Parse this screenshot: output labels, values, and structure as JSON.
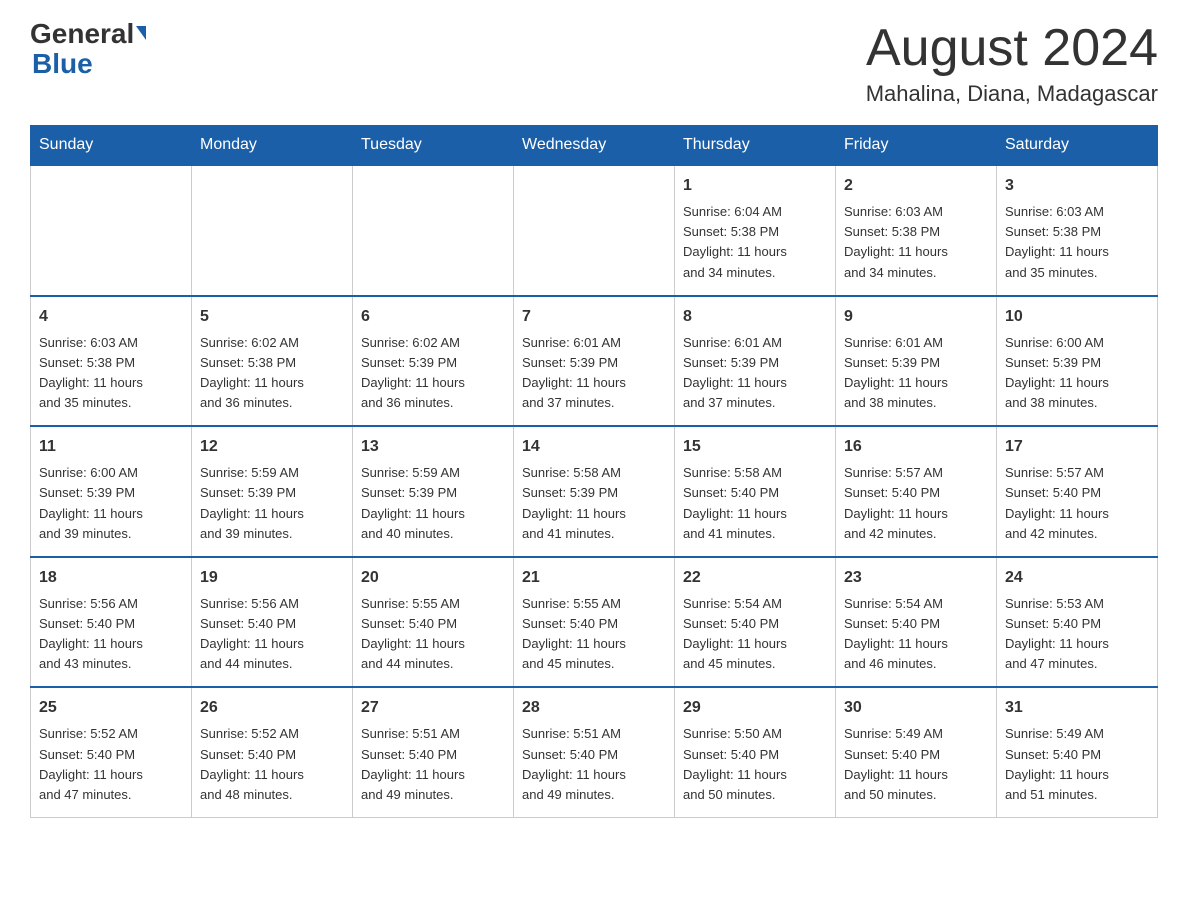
{
  "logo": {
    "general": "General",
    "blue": "Blue"
  },
  "title": "August 2024",
  "subtitle": "Mahalina, Diana, Madagascar",
  "days_of_week": [
    "Sunday",
    "Monday",
    "Tuesday",
    "Wednesday",
    "Thursday",
    "Friday",
    "Saturday"
  ],
  "weeks": [
    [
      {
        "day": "",
        "info": ""
      },
      {
        "day": "",
        "info": ""
      },
      {
        "day": "",
        "info": ""
      },
      {
        "day": "",
        "info": ""
      },
      {
        "day": "1",
        "info": "Sunrise: 6:04 AM\nSunset: 5:38 PM\nDaylight: 11 hours\nand 34 minutes."
      },
      {
        "day": "2",
        "info": "Sunrise: 6:03 AM\nSunset: 5:38 PM\nDaylight: 11 hours\nand 34 minutes."
      },
      {
        "day": "3",
        "info": "Sunrise: 6:03 AM\nSunset: 5:38 PM\nDaylight: 11 hours\nand 35 minutes."
      }
    ],
    [
      {
        "day": "4",
        "info": "Sunrise: 6:03 AM\nSunset: 5:38 PM\nDaylight: 11 hours\nand 35 minutes."
      },
      {
        "day": "5",
        "info": "Sunrise: 6:02 AM\nSunset: 5:38 PM\nDaylight: 11 hours\nand 36 minutes."
      },
      {
        "day": "6",
        "info": "Sunrise: 6:02 AM\nSunset: 5:39 PM\nDaylight: 11 hours\nand 36 minutes."
      },
      {
        "day": "7",
        "info": "Sunrise: 6:01 AM\nSunset: 5:39 PM\nDaylight: 11 hours\nand 37 minutes."
      },
      {
        "day": "8",
        "info": "Sunrise: 6:01 AM\nSunset: 5:39 PM\nDaylight: 11 hours\nand 37 minutes."
      },
      {
        "day": "9",
        "info": "Sunrise: 6:01 AM\nSunset: 5:39 PM\nDaylight: 11 hours\nand 38 minutes."
      },
      {
        "day": "10",
        "info": "Sunrise: 6:00 AM\nSunset: 5:39 PM\nDaylight: 11 hours\nand 38 minutes."
      }
    ],
    [
      {
        "day": "11",
        "info": "Sunrise: 6:00 AM\nSunset: 5:39 PM\nDaylight: 11 hours\nand 39 minutes."
      },
      {
        "day": "12",
        "info": "Sunrise: 5:59 AM\nSunset: 5:39 PM\nDaylight: 11 hours\nand 39 minutes."
      },
      {
        "day": "13",
        "info": "Sunrise: 5:59 AM\nSunset: 5:39 PM\nDaylight: 11 hours\nand 40 minutes."
      },
      {
        "day": "14",
        "info": "Sunrise: 5:58 AM\nSunset: 5:39 PM\nDaylight: 11 hours\nand 41 minutes."
      },
      {
        "day": "15",
        "info": "Sunrise: 5:58 AM\nSunset: 5:40 PM\nDaylight: 11 hours\nand 41 minutes."
      },
      {
        "day": "16",
        "info": "Sunrise: 5:57 AM\nSunset: 5:40 PM\nDaylight: 11 hours\nand 42 minutes."
      },
      {
        "day": "17",
        "info": "Sunrise: 5:57 AM\nSunset: 5:40 PM\nDaylight: 11 hours\nand 42 minutes."
      }
    ],
    [
      {
        "day": "18",
        "info": "Sunrise: 5:56 AM\nSunset: 5:40 PM\nDaylight: 11 hours\nand 43 minutes."
      },
      {
        "day": "19",
        "info": "Sunrise: 5:56 AM\nSunset: 5:40 PM\nDaylight: 11 hours\nand 44 minutes."
      },
      {
        "day": "20",
        "info": "Sunrise: 5:55 AM\nSunset: 5:40 PM\nDaylight: 11 hours\nand 44 minutes."
      },
      {
        "day": "21",
        "info": "Sunrise: 5:55 AM\nSunset: 5:40 PM\nDaylight: 11 hours\nand 45 minutes."
      },
      {
        "day": "22",
        "info": "Sunrise: 5:54 AM\nSunset: 5:40 PM\nDaylight: 11 hours\nand 45 minutes."
      },
      {
        "day": "23",
        "info": "Sunrise: 5:54 AM\nSunset: 5:40 PM\nDaylight: 11 hours\nand 46 minutes."
      },
      {
        "day": "24",
        "info": "Sunrise: 5:53 AM\nSunset: 5:40 PM\nDaylight: 11 hours\nand 47 minutes."
      }
    ],
    [
      {
        "day": "25",
        "info": "Sunrise: 5:52 AM\nSunset: 5:40 PM\nDaylight: 11 hours\nand 47 minutes."
      },
      {
        "day": "26",
        "info": "Sunrise: 5:52 AM\nSunset: 5:40 PM\nDaylight: 11 hours\nand 48 minutes."
      },
      {
        "day": "27",
        "info": "Sunrise: 5:51 AM\nSunset: 5:40 PM\nDaylight: 11 hours\nand 49 minutes."
      },
      {
        "day": "28",
        "info": "Sunrise: 5:51 AM\nSunset: 5:40 PM\nDaylight: 11 hours\nand 49 minutes."
      },
      {
        "day": "29",
        "info": "Sunrise: 5:50 AM\nSunset: 5:40 PM\nDaylight: 11 hours\nand 50 minutes."
      },
      {
        "day": "30",
        "info": "Sunrise: 5:49 AM\nSunset: 5:40 PM\nDaylight: 11 hours\nand 50 minutes."
      },
      {
        "day": "31",
        "info": "Sunrise: 5:49 AM\nSunset: 5:40 PM\nDaylight: 11 hours\nand 51 minutes."
      }
    ]
  ]
}
